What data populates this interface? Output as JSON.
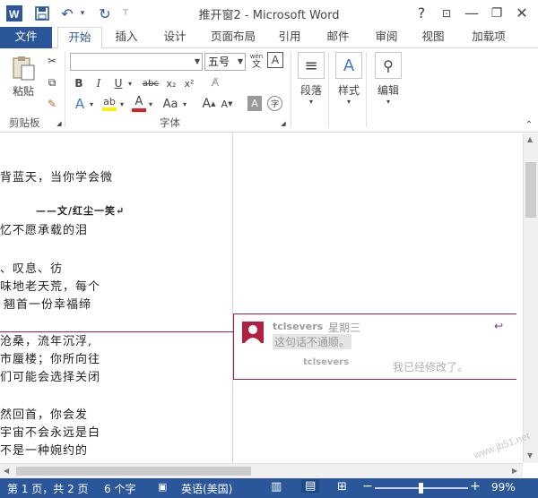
{
  "titlebar": {
    "title": "推开窗2 - Microsoft Word",
    "help": "?",
    "minimize": "—",
    "restore": "❐",
    "close": "✕"
  },
  "tabs": [
    "文件",
    "开始",
    "插入",
    "设计",
    "页面布局",
    "引用",
    "邮件",
    "审阅",
    "视图",
    "加载项"
  ],
  "ribbon": {
    "clipboard": {
      "paste": "粘贴",
      "group": "剪贴板"
    },
    "font": {
      "name_value": "",
      "size_value": "五号",
      "wen": "wén",
      "group": "字体",
      "bold": "B",
      "italic": "I",
      "underline": "U",
      "strike": "abc",
      "sub": "x₂",
      "sup": "x²",
      "grow": "A",
      "shrink": "A",
      "case": "Aa"
    },
    "paragraph": {
      "label": "段落"
    },
    "styles": {
      "label": "样式"
    },
    "editing": {
      "label": "编辑"
    }
  },
  "document": {
    "lines": [
      "背蓝天，当你学会微",
      "——文/红尘一笑↵",
      "忆不愿承载的泪",
      "、叹息、彷",
      "味地老天荒，每个",
      "翘首一份幸福缔",
      "沧桑，流年沉浮,",
      "市蜃楼；你所向往",
      "们可能会选择关闭",
      "然回首，你会发",
      "宇宙不会永远是白",
      "不是一种婉约的"
    ]
  },
  "comment": {
    "author": "tclsevers",
    "day": "星期三",
    "text": "这句话不通顺。",
    "reply_author": "tclsevers",
    "reply_text": "我已经修改了。"
  },
  "statusbar": {
    "page": "第 1 页，共 2 页",
    "words": "6 个字",
    "lang": "英语(美国)",
    "zoom": "99%",
    "minus": "−",
    "plus": "+"
  },
  "watermark": "www.jb51.net"
}
